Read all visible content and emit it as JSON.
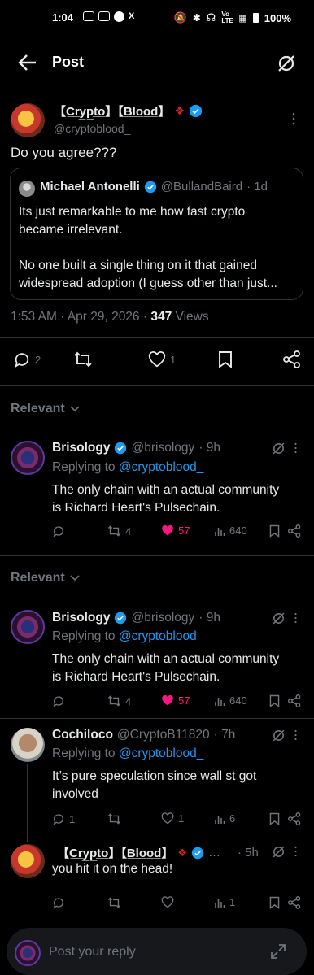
{
  "status_bar": {
    "time": "1:04",
    "battery": "100%",
    "network": "Vo LTE"
  },
  "header": {
    "title": "Post"
  },
  "main_post": {
    "display_name": "【C̲r̲y̲p̲t̲o̲】【B̲l̲o̲o̲d̲】",
    "handle": "@cryptoblood_",
    "text": "Do you agree???",
    "quote": {
      "name": "Michael Antonelli",
      "handle": "@BullandBaird",
      "time": "· 1d",
      "line1": "Its just remarkable to me how fast crypto",
      "line2": "became irrelevant.",
      "line3": "No one built a single thing on it that gained",
      "line4": "widespread adoption (I guess other than just..."
    },
    "timestamp": "1:53 AM · Apr 29, 2026 · ",
    "views_count": "347",
    "views_label": " Views",
    "replies": "2",
    "likes": "1"
  },
  "sort_label": "Relevant",
  "replies": [
    {
      "name": "Brisology",
      "handle": "@brisology",
      "time": "· 9h",
      "replying_prefix": "Replying to ",
      "replying_to": "@cryptoblood_",
      "line1": "The only chain with an actual community",
      "line2": "is Richard Heart's Pulsechain.",
      "retweets": "4",
      "likes": "57",
      "views": "640"
    },
    {
      "name": "Brisology",
      "handle": "@brisology",
      "time": "· 9h",
      "replying_prefix": "Replying to ",
      "replying_to": "@cryptoblood_",
      "line1": "The only chain with an actual community",
      "line2": "is Richard Heart's Pulsechain.",
      "retweets": "4",
      "likes": "57",
      "views": "640"
    },
    {
      "name": "Cochiloco",
      "handle": "@CryptoB11820",
      "time": "· 7h",
      "replying_prefix": "Replying to ",
      "replying_to": "@cryptoblood_",
      "line1": "It’s pure speculation since wall st got",
      "line2": "involved",
      "replies": "1",
      "likes": "1",
      "views": "6"
    },
    {
      "name": "【C̲r̲y̲p̲t̲o̲】【B̲l̲o̲o̲d̲】",
      "extra": "…",
      "time": "· 5h",
      "line1": "you hit it on the head!",
      "views": "1"
    }
  ],
  "reply_composer": {
    "placeholder": "Post your reply"
  },
  "colors": {
    "accent": "#1d9bf0",
    "like": "#f91880",
    "bg": "#000000"
  }
}
